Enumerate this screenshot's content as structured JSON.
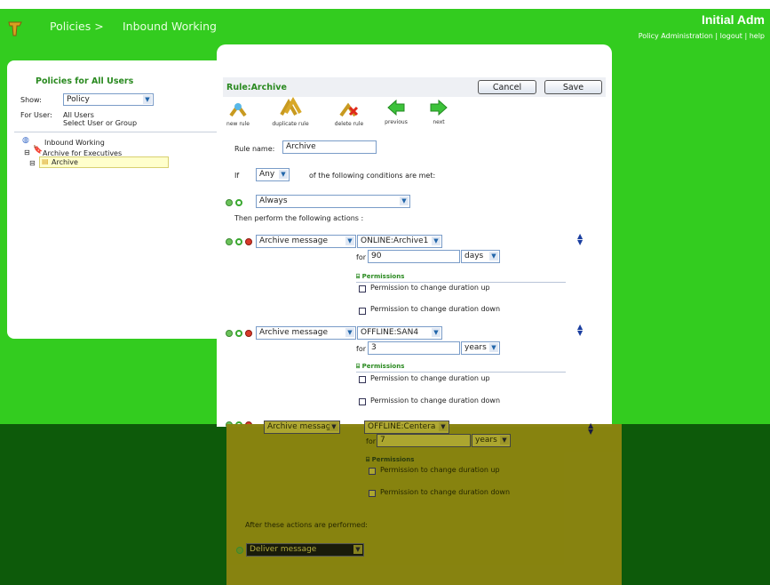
{
  "header": {
    "breadcrumb": [
      "Policies >",
      "Inbound Working"
    ],
    "brand": "Initial Adm",
    "links": [
      "Policy Administration",
      "logout",
      "help"
    ],
    "link_sep": " | "
  },
  "left_panel": {
    "title": "Policies for All Users",
    "show_label": "Show:",
    "show_value": "Policy",
    "for_user_label": "For User:",
    "for_user_value": "All Users",
    "select_link": "Select User or Group",
    "tree": [
      "Inbound Working",
      "Archive for Executives",
      "Archive"
    ]
  },
  "rule": {
    "title": "Rule:Archive",
    "cancel_label": "Cancel",
    "save_label": "Save",
    "tools": [
      "new rule",
      "duplicate rule",
      "delete rule",
      "previous",
      "next"
    ],
    "name_label": "Rule name:",
    "name_value": "Archive",
    "if_label": "If",
    "match_value": "Any",
    "conditions_text": "of the following conditions are met:",
    "condition_value": "Always",
    "then_text": "Then perform the following actions :",
    "for_label": "for",
    "permissions_title": "Permissions",
    "perm_up": "Permission to change duration up",
    "perm_down": "Permission to change duration down",
    "actions": [
      {
        "action": "Archive message",
        "target": "ONLINE:Archive1",
        "duration": "90",
        "unit": "days"
      },
      {
        "action": "Archive message",
        "target": "OFFLINE:SAN4",
        "duration": "3",
        "unit": "years"
      },
      {
        "action": "Archive message",
        "target": "OFFLINE:Centera",
        "duration": "7",
        "unit": "years"
      }
    ],
    "after_text": "After these actions are performed:",
    "after_value": "Deliver message"
  }
}
